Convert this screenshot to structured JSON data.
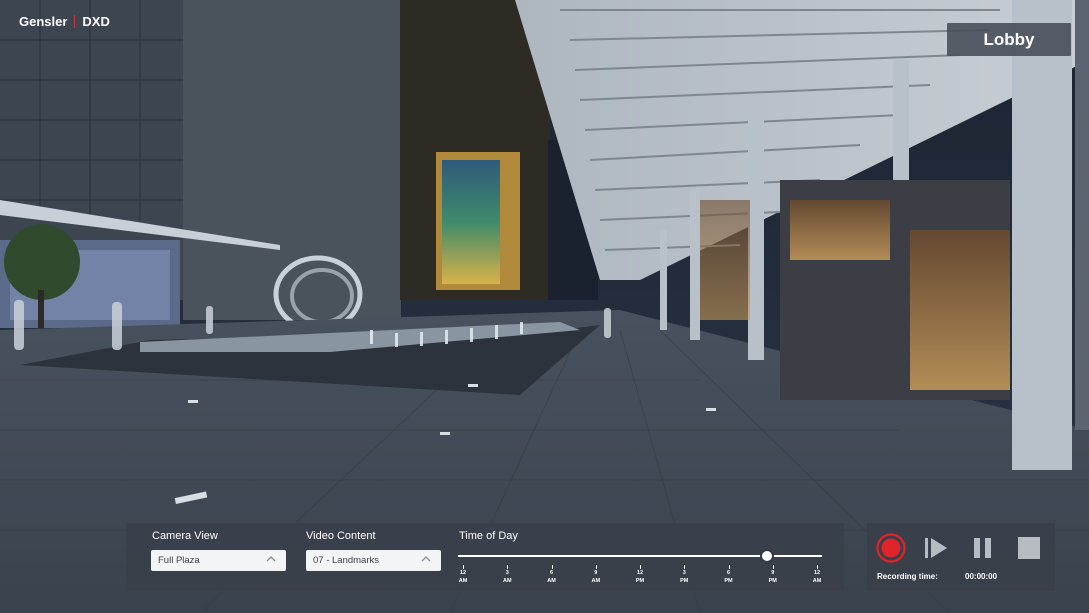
{
  "brand": {
    "company": "Gensler",
    "division": "DXD"
  },
  "location_label": "Lobby",
  "controls": {
    "camera_view": {
      "label": "Camera View",
      "value": "Full Plaza"
    },
    "video_content": {
      "label": "Video Content",
      "value": "07 - Landmarks"
    },
    "time_of_day": {
      "label": "Time of Day",
      "ticks": [
        {
          "hour": "12",
          "period": "AM"
        },
        {
          "hour": "3",
          "period": "AM"
        },
        {
          "hour": "6",
          "period": "AM"
        },
        {
          "hour": "9",
          "period": "AM"
        },
        {
          "hour": "12",
          "period": "PM"
        },
        {
          "hour": "3",
          "period": "PM"
        },
        {
          "hour": "6",
          "period": "PM"
        },
        {
          "hour": "9",
          "period": "PM"
        },
        {
          "hour": "12",
          "period": "AM"
        }
      ],
      "value_fraction": 0.86
    }
  },
  "recorder": {
    "recording_time_label": "Recording time:",
    "recording_time_value": "00:00:00",
    "record_color": "#e0242c"
  },
  "icons": {
    "record": "record-icon",
    "play": "play-icon",
    "pause": "pause-icon",
    "stop": "stop-icon",
    "dropdown": "chevron-up-icon"
  }
}
